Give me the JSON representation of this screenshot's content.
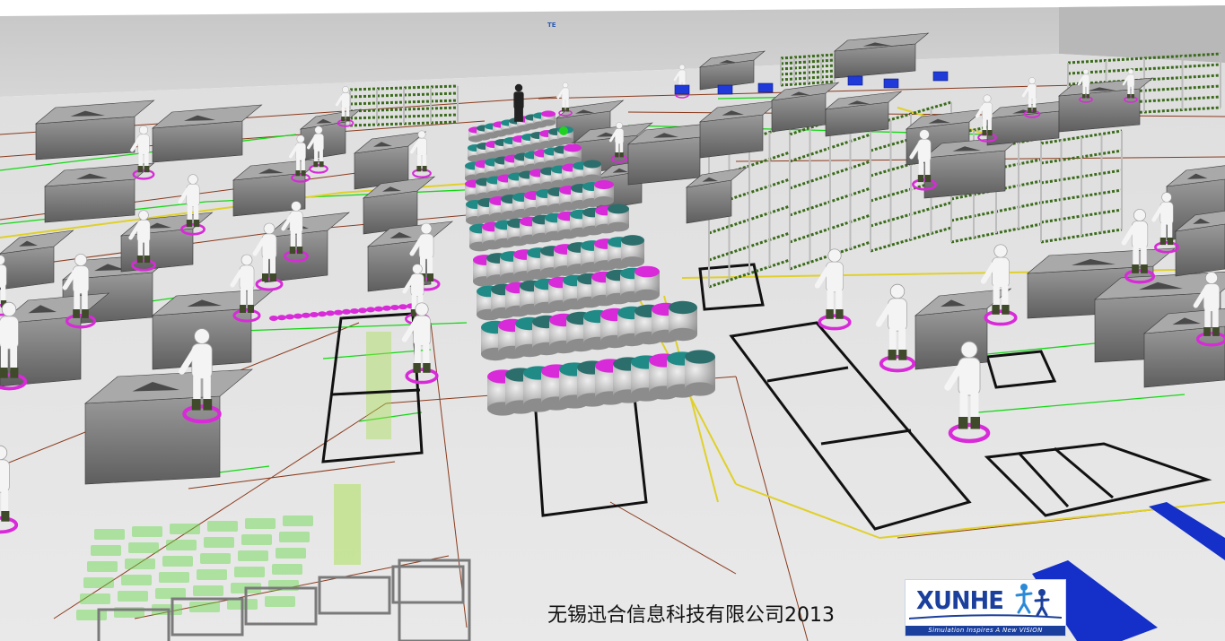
{
  "scene": {
    "description": "",
    "colors": {
      "floor": "#e1e1e1",
      "wall_top": "#c6c6c6",
      "wall_bottom": "#d6d6d6",
      "machine": "#7f7f7f",
      "machine_dark": "#4a4a4a",
      "worker": "#f4f4f4",
      "boot": "#3f4a2a",
      "magenta": "#d82ad8",
      "teal": "#1f8a86",
      "green_line": "#14d814",
      "brown_line": "#8a3a1c",
      "yellow_line": "#e0d02a",
      "blue_band": "#1430c8",
      "rack_green": "#3a6b1a"
    }
  },
  "wall_mark": "TE",
  "caption": "无锡迅合信息科技有限公司2013",
  "logo": {
    "wordmark": "XUNHE",
    "tagline": "Simulation Inspires A New VISION",
    "brand_color": "#1b3f9c",
    "accent_color": "#2a8ad8"
  }
}
